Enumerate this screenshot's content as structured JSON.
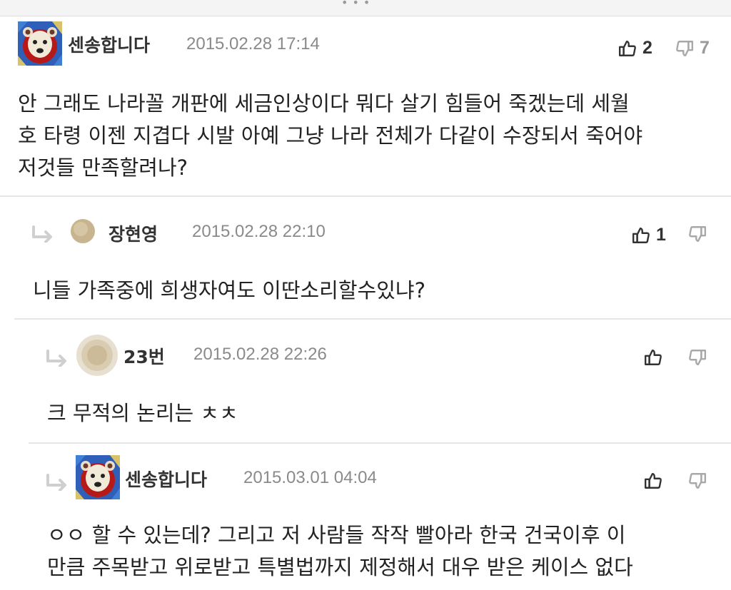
{
  "comments": [
    {
      "username": "센송합니다",
      "timestamp": "2015.02.28 17:14",
      "likes": "2",
      "dislikes": "7",
      "lines": [
        "안 그래도 나라꼴 개판에 세금인상이다 뭐다 살기 힘들어 죽겠는데 세월",
        "호 타령 이젠 지겹다 시발 아예 그냥 나라 전체가 다같이 수장되서 죽어야",
        "저것들 만족할려나?"
      ]
    },
    {
      "username": "장현영",
      "timestamp": "2015.02.28 22:10",
      "likes": "1",
      "lines": [
        "니들 가족중에 희생자여도 이딴소리할수있냐?"
      ]
    },
    {
      "username": "23번",
      "timestamp": "2015.02.28 22:26",
      "lines": [
        "크 무적의 논리는 ㅊㅊ"
      ]
    },
    {
      "username": "센송합니다",
      "timestamp": "2015.03.01 04:04",
      "lines": [
        "ㅇㅇ 할 수 있는데? 그리고 저 사람들 작작 빨아라 한국 건국이후 이",
        "만큼 주목받고 위로받고 특별법까지 제정해서 대우 받은 케이스 없다"
      ]
    }
  ],
  "icons": {
    "like": "thumbs-up-icon",
    "dislike": "thumbs-down-icon",
    "reply": "reply-arrow-icon"
  },
  "colors": {
    "text": "#222222",
    "meta": "#8a8a8a",
    "icon_active": "#333333",
    "icon_muted": "#a8a8a8",
    "divider": "#e6e6e6"
  }
}
